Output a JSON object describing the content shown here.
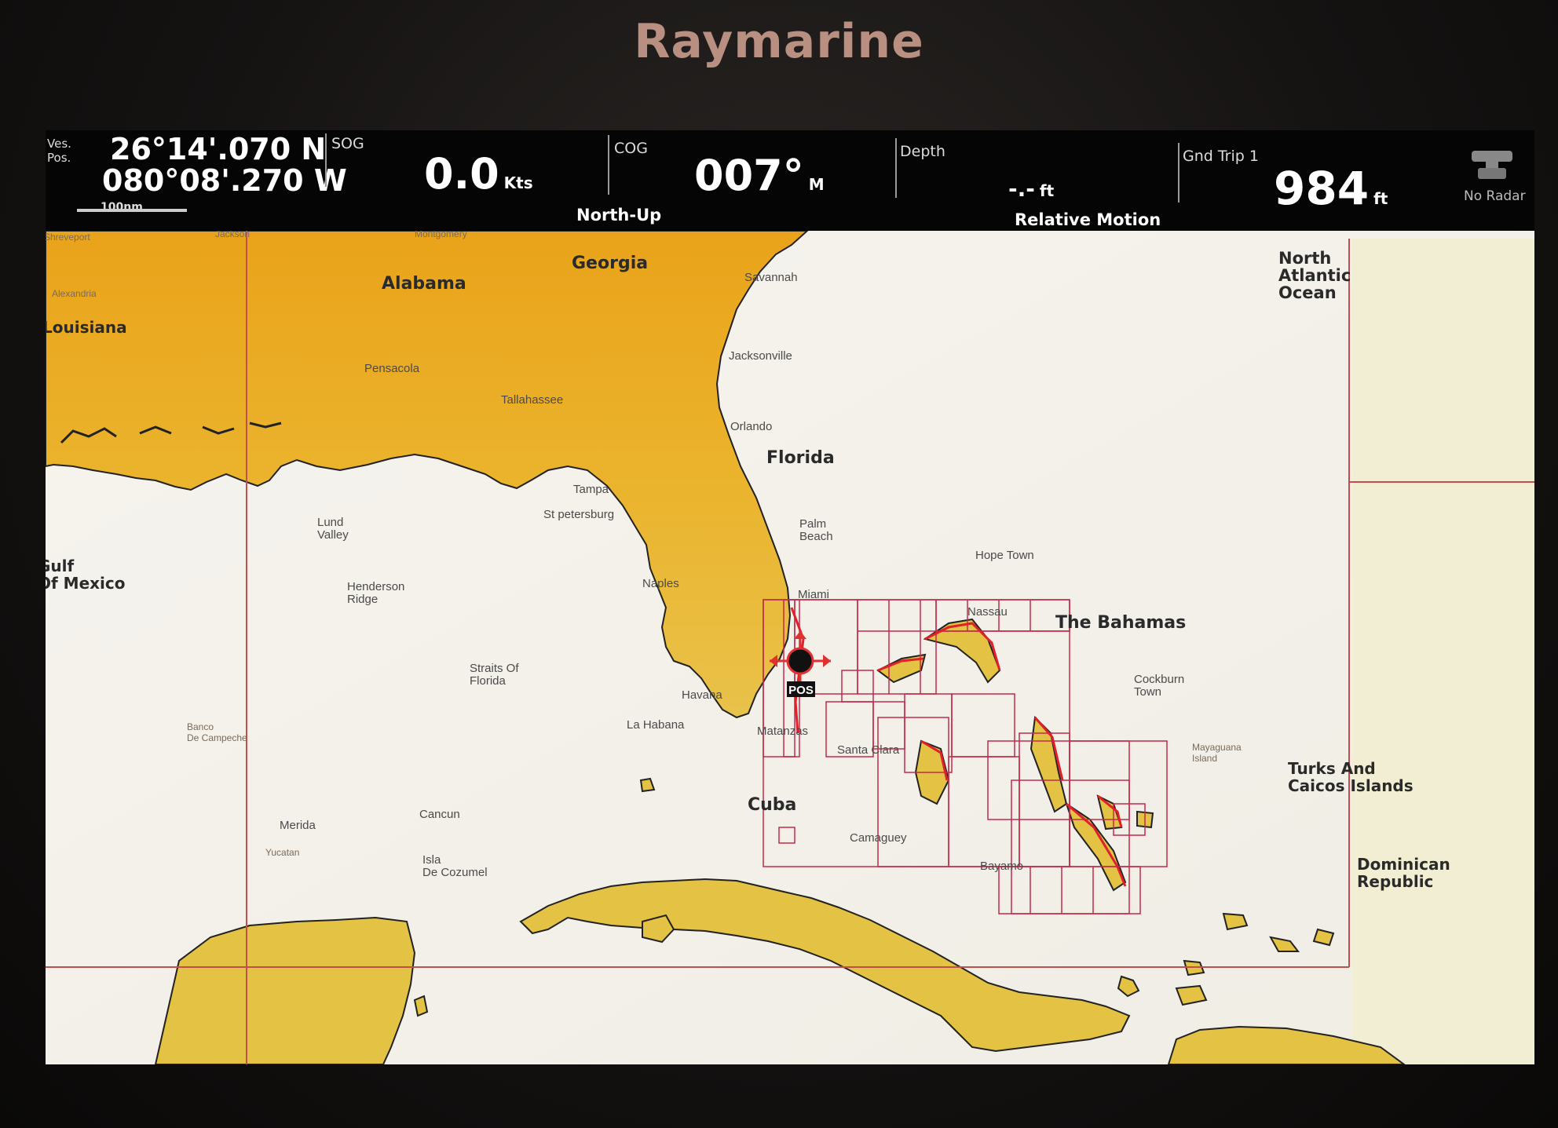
{
  "device": {
    "brand": "Raymarine"
  },
  "databar": {
    "pos_label": "Ves. Pos.",
    "latitude": "26°14'.070 N",
    "longitude": "080°08'.270 W",
    "scale": "100nm",
    "sog_label": "SOG",
    "sog_value": "0.0",
    "sog_unit": "Kts",
    "orientation": "North-Up",
    "cog_label": "COG",
    "cog_value": "007°",
    "cog_unit": "M",
    "depth_label": "Depth",
    "depth_value": "-.-",
    "depth_unit": "ft",
    "motion_mode": "Relative Motion",
    "trip_label": "Gnd Trip 1",
    "trip_value": "984",
    "trip_unit": "ft",
    "radar_status": "No Radar"
  },
  "map": {
    "regions": {
      "georgia": "Georgia",
      "alabama": "Alabama",
      "louisiana": "Louisiana",
      "florida": "Florida",
      "bahamas": "The Bahamas",
      "cuba": "Cuba",
      "atlantic": [
        "North",
        "Atlantic",
        "Ocean"
      ],
      "gulf": [
        "Gulf",
        "Of Mexico"
      ],
      "turks": [
        "Turks And",
        "Caicos Islands"
      ],
      "dominican": [
        "Dominican",
        "Republic"
      ]
    },
    "cities": {
      "savannah": "Savannah",
      "jacksonville": "Jacksonville",
      "orlando": "Orlando",
      "tampa": "Tampa",
      "stpetersburg": "St petersburg",
      "naples": "Naples",
      "miami": "Miami",
      "palmbeach": [
        "Palm",
        "Beach"
      ],
      "hopetown": "Hope Town",
      "nassau": "Nassau",
      "cockburn": [
        "Cockburn",
        "Town"
      ],
      "mayaguana": [
        "Mayaguana",
        "Island"
      ],
      "havana": "Havana",
      "lahabana": "La Habana",
      "matanzas": "Matanzas",
      "santaclara": "Santa Clara",
      "camaguey": "Camaguey",
      "bayamo": "Bayamo",
      "cancun": "Cancun",
      "merida": "Merida",
      "yucatan": "Yucatan",
      "cozumel": [
        "Isla",
        "De Cozumel"
      ],
      "pensacola": "Pensacola",
      "tallahassee": "Tallahassee",
      "montgomery": "Montgomery",
      "jackson": "Jackson",
      "shreveport": "Shreveport",
      "alexandria": "Alexandria"
    },
    "features": {
      "lund": [
        "Lund",
        "Valley"
      ],
      "henderson": [
        "Henderson",
        "Ridge"
      ],
      "straits": [
        "Straits Of",
        "Florida"
      ],
      "banco": [
        "Banco",
        "De Campeche"
      ],
      "pos_marker": "POS"
    }
  }
}
